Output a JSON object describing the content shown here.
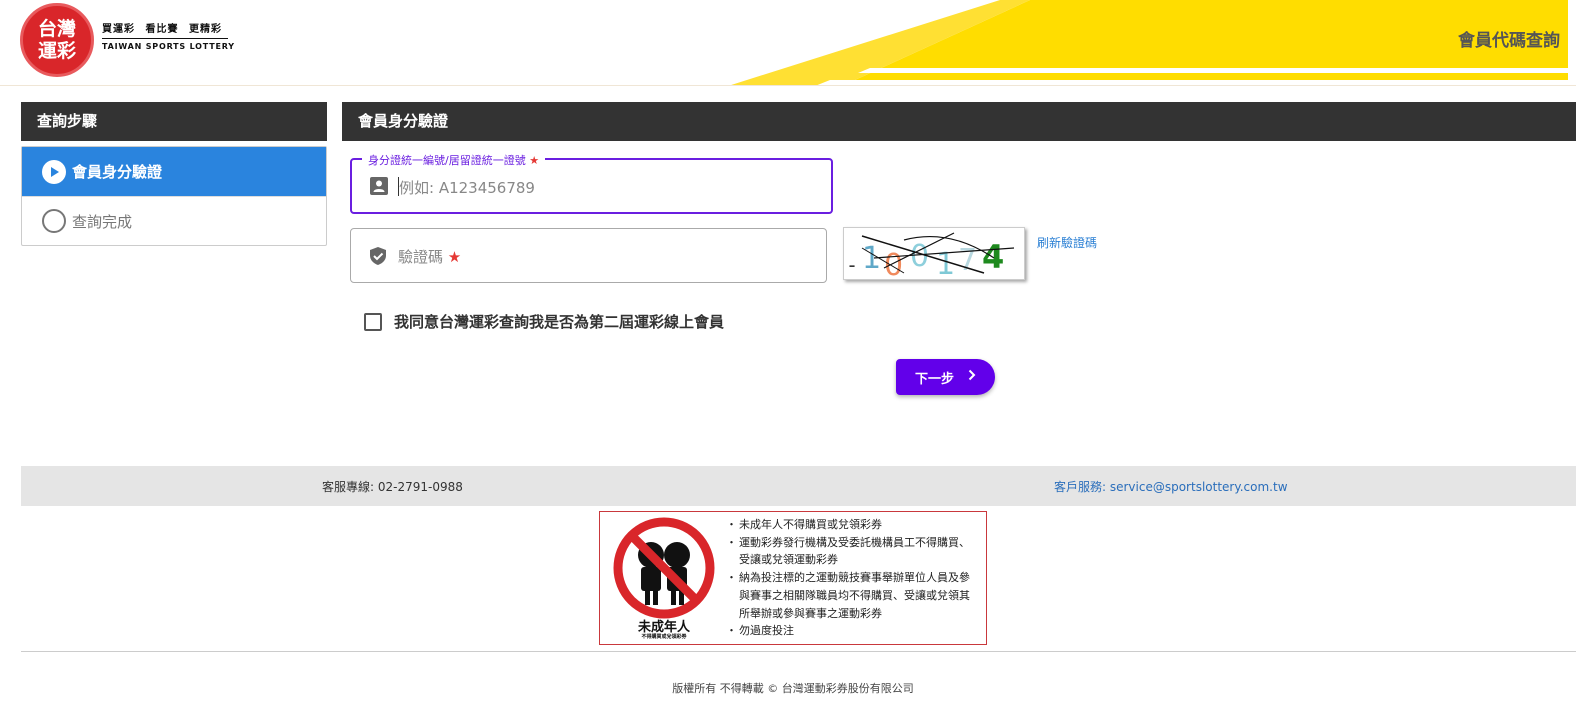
{
  "header": {
    "logo_line1": "台灣",
    "logo_line2": "運彩",
    "slogan": "買運彩 看比賽 更精彩",
    "brand_en": "TAIWAN SPORTS LOTTERY",
    "page_title": "會員代碼查詢"
  },
  "steps": {
    "title": "查詢步驟",
    "items": [
      {
        "label": "會員身分驗證",
        "state": "active"
      },
      {
        "label": "查詢完成",
        "state": "inactive"
      }
    ]
  },
  "form": {
    "title": "會員身分驗證",
    "id_field": {
      "label": "身分證統一編號/居留證統一證號",
      "required_mark": "★",
      "placeholder": "例如: A123456789",
      "value": ""
    },
    "captcha_field": {
      "placeholder": "驗證碼",
      "required_mark": "★",
      "value": ""
    },
    "captcha_text": "-100174",
    "refresh_label": "刷新驗證碼",
    "agree_label": "我同意台灣運彩查詢我是否為第二屆運彩線上會員",
    "agree_checked": false,
    "next_label": "下一步"
  },
  "footer": {
    "phone": "客服專線: 02-2791-0988",
    "email": "客戶服務: service@sportslottery.com.tw",
    "warning_caption": "未成年人",
    "warning_subcaption": "不得購買或兌領彩券",
    "warnings": [
      "未成年人不得購買或兌領彩券",
      "運動彩券發行機構及受委託機構員工不得購買、受讓或兌領運動彩券",
      "納為投注標的之運動競技賽事舉辦單位人員及參與賽事之相關隊職員均不得購買、受讓或兌領其所舉辦或參與賽事之運動彩券",
      "勿過度投注"
    ],
    "copyright": "版權所有 不得轉載 © 台灣運動彩券股份有限公司"
  },
  "colors": {
    "brand_red": "#d9262a",
    "header_yellow": "#ffdd00",
    "step_active_blue": "#2a84de",
    "accent_purple": "#6200ea",
    "dark_bar": "#333333"
  }
}
